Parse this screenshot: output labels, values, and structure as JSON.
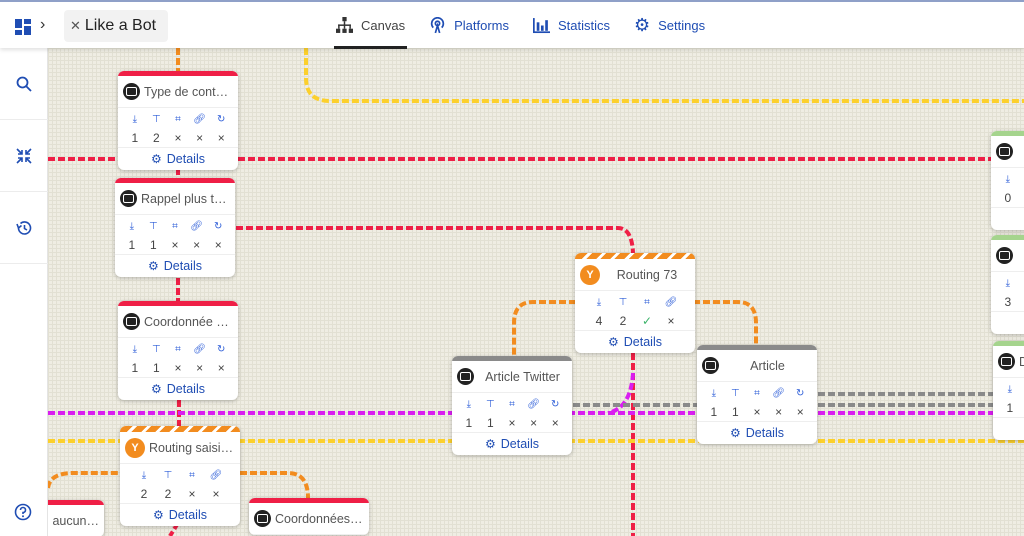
{
  "header": {
    "bot_name": "Like a Bot",
    "tabs": [
      {
        "label": "Canvas",
        "icon": "sitemap-icon",
        "active": true
      },
      {
        "label": "Platforms",
        "icon": "broadcast-icon",
        "active": false
      },
      {
        "label": "Statistics",
        "icon": "bar-chart-icon",
        "active": false
      },
      {
        "label": "Settings",
        "icon": "gear-icon",
        "active": false
      }
    ]
  },
  "sidebar": {
    "items": [
      "search",
      "collapse",
      "history"
    ],
    "help": "help"
  },
  "colors": {
    "accent": "#1f4db3",
    "red": "#ef1f46",
    "orange": "#f28c1f",
    "yellow": "#fcd02c",
    "magenta": "#d91ef0",
    "grey": "#8a8a8a",
    "green": "#a5d48d"
  },
  "node_common": {
    "details_label": "Details",
    "stat_icons": [
      "↧",
      "⤓",
      "⌗",
      "🔗",
      "↻"
    ]
  },
  "nodes": [
    {
      "id": "n1",
      "title": "Type de cont…",
      "kind": "message",
      "bar": "red",
      "stats": [
        "1",
        "2",
        "×",
        "×",
        "×"
      ]
    },
    {
      "id": "n2",
      "title": "Rappel plus t…",
      "kind": "message",
      "bar": "red",
      "stats": [
        "1",
        "1",
        "×",
        "×",
        "×"
      ]
    },
    {
      "id": "n3",
      "title": "Coordonnée …",
      "kind": "message",
      "bar": "red",
      "stats": [
        "1",
        "1",
        "×",
        "×",
        "×"
      ]
    },
    {
      "id": "n4",
      "title": "Routing saisi…",
      "kind": "routing",
      "bar": "stripe",
      "stats": [
        "2",
        "2",
        "×",
        "×"
      ]
    },
    {
      "id": "n5",
      "title": "Routing 73",
      "kind": "routing",
      "bar": "stripe",
      "stats": [
        "4",
        "2",
        "✓",
        "×"
      ]
    },
    {
      "id": "n6",
      "title": "Article Twitter",
      "kind": "message",
      "bar": "grey",
      "stats": [
        "1",
        "1",
        "×",
        "×",
        "×"
      ]
    },
    {
      "id": "n7",
      "title": "Article",
      "kind": "message",
      "bar": "grey",
      "stats": [
        "1",
        "1",
        "×",
        "×",
        "×"
      ]
    },
    {
      "id": "n8",
      "title": "… aucun…",
      "kind": "message",
      "bar": "red",
      "stats": []
    },
    {
      "id": "n9",
      "title": "Coordonnées…",
      "kind": "message",
      "bar": "red",
      "stats": []
    },
    {
      "id": "n10",
      "title": "",
      "kind": "message",
      "bar": "green",
      "stats": [
        "0"
      ]
    },
    {
      "id": "n11",
      "title": "",
      "kind": "message",
      "bar": "green",
      "stats": [
        "3"
      ]
    },
    {
      "id": "n12",
      "title": "D",
      "kind": "message",
      "bar": "green",
      "stats": [
        "1"
      ]
    }
  ]
}
